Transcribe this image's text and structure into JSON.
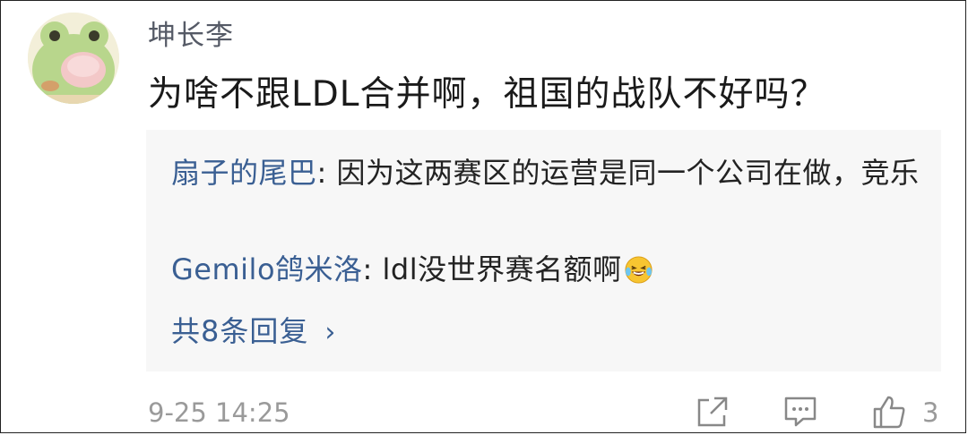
{
  "comment": {
    "username": "坤长李",
    "text": "为啥不跟LDL合并啊，祖国的战队不好吗？",
    "timestamp": "9-25 14:25",
    "like_count": "3"
  },
  "replies": [
    {
      "name": "扇子的尾巴",
      "separator": ": ",
      "text": "因为这两赛区的运营是同一个公司在做，竞乐"
    },
    {
      "name": "Gemilo鸽米洛",
      "separator": ": ",
      "text": "ldl没世界赛名额啊",
      "emoji": "laughing-tears-emoji"
    }
  ],
  "more_replies": {
    "label": "共8条回复",
    "chevron": "›"
  },
  "icons": {
    "share": "share-icon",
    "reply": "comment-icon",
    "like": "thumbs-up-icon"
  },
  "colors": {
    "link": "#3a5f93",
    "reply_bg": "#f7f7f7",
    "meta": "#9a9a9a"
  }
}
